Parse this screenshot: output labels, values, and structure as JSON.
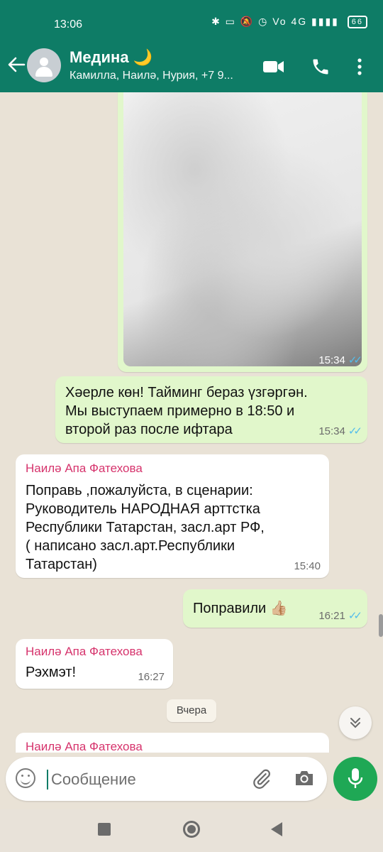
{
  "status": {
    "time": "13:06",
    "icons_text": "✱ ▭ 🔕 ◷ Vo 4G ▮▮▮▮",
    "battery": "66"
  },
  "header": {
    "title": "Медина 🌙",
    "subtitle": "Камилла, Наилә, Нурия, +7 9..."
  },
  "messages": [
    {
      "type": "image",
      "direction": "out",
      "time": "15:34",
      "ticks": "✓✓"
    },
    {
      "type": "text",
      "direction": "out",
      "lines": [
        "Хәерле көн! Тайминг бераз үзгәргән.",
        "Мы выступаем примерно в 18:50 и",
        "второй раз после ифтара"
      ],
      "time": "15:34",
      "ticks": "✓✓"
    },
    {
      "type": "text",
      "direction": "in",
      "sender": "Наилә Апа Фатехова",
      "lines": [
        "Поправь ,пожалуйста, в сценарии:",
        "Руководитель НАРОДНАЯ арттстка",
        "Республики Татарстан, засл.арт РФ,",
        "( написано засл.арт.Республики",
        "Татарстан)"
      ],
      "time": "15:40"
    },
    {
      "type": "text",
      "direction": "out",
      "lines": [
        "Поправили 👍🏼"
      ],
      "time": "16:21",
      "ticks": "✓✓"
    },
    {
      "type": "text",
      "direction": "in",
      "sender": "Наилә Апа Фатехова",
      "lines": [
        "Рэхмэт!"
      ],
      "time": "16:27"
    },
    {
      "type": "date",
      "label": "Вчера"
    },
    {
      "type": "text",
      "direction": "in",
      "sender": "Наилә Апа Фатехова",
      "lines": [],
      "time": ""
    }
  ],
  "composer": {
    "placeholder": "Сообщение"
  },
  "colors": {
    "header": "#0e7c66",
    "outgoing_bubble": "#e1f7cb",
    "incoming_bubble": "#ffffff",
    "sender_name": "#d6336c",
    "read_ticks": "#53bdeb",
    "mic_button": "#1fa855"
  },
  "icons": [
    "back-arrow-icon",
    "group-avatar-icon",
    "video-call-icon",
    "phone-icon",
    "more-vert-icon",
    "emoji-icon",
    "attach-icon",
    "camera-icon",
    "mic-icon",
    "chevrons-down-icon"
  ]
}
